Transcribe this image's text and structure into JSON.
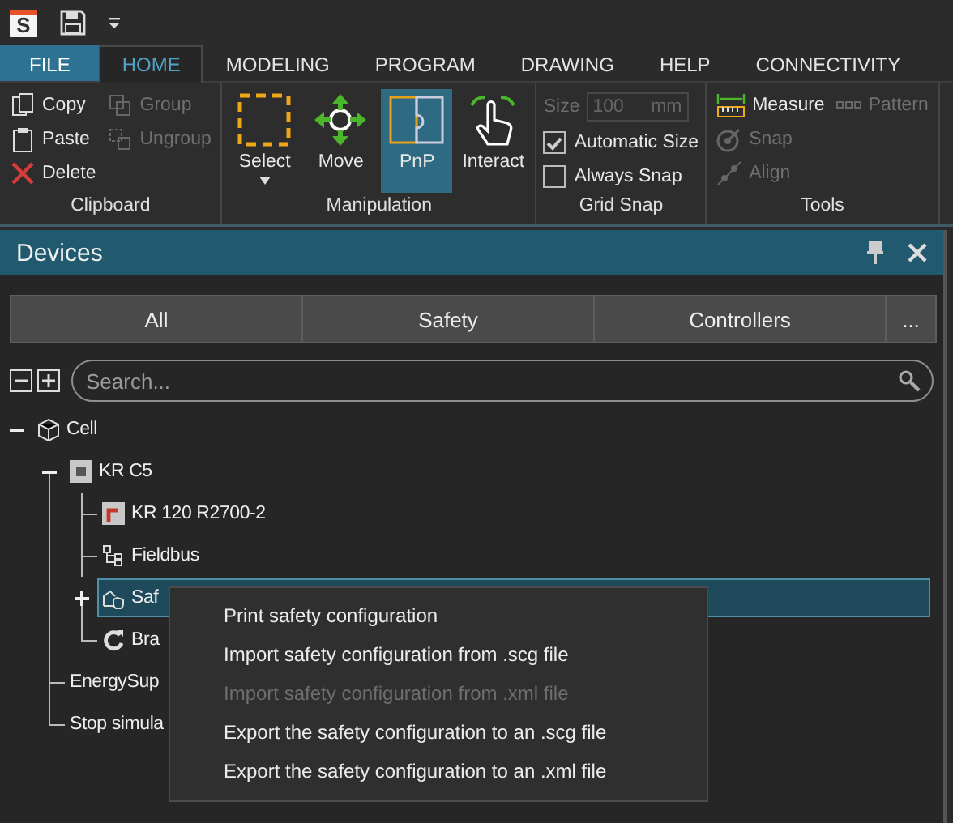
{
  "title_bar": {
    "logo": "S"
  },
  "ribbon": {
    "tabs": [
      {
        "label": "FILE",
        "kind": "file",
        "selected": false
      },
      {
        "label": "HOME",
        "kind": "tab",
        "selected": true
      },
      {
        "label": "MODELING",
        "kind": "tab",
        "selected": false
      },
      {
        "label": "PROGRAM",
        "kind": "tab",
        "selected": false
      },
      {
        "label": "DRAWING",
        "kind": "tab",
        "selected": false
      },
      {
        "label": "HELP",
        "kind": "tab",
        "selected": false
      },
      {
        "label": "CONNECTIVITY",
        "kind": "tab",
        "selected": false
      }
    ],
    "groups": [
      {
        "label": "Clipboard",
        "columns": [
          [
            {
              "kind": "small",
              "label": "Copy",
              "disabled": false
            },
            {
              "kind": "small",
              "label": "Paste",
              "disabled": false
            },
            {
              "kind": "small",
              "label": "Delete",
              "disabled": false
            }
          ],
          [
            {
              "kind": "small",
              "label": "Group",
              "disabled": true
            },
            {
              "kind": "small",
              "label": "Ungroup",
              "disabled": true
            }
          ]
        ]
      },
      {
        "label": "Manipulation",
        "columns": [
          [
            {
              "kind": "large",
              "label": "Select",
              "dropdown": true,
              "selected": false
            }
          ],
          [
            {
              "kind": "large",
              "label": "Move",
              "selected": false
            }
          ],
          [
            {
              "kind": "large",
              "label": "PnP",
              "selected": true
            }
          ],
          [
            {
              "kind": "large",
              "label": "Interact",
              "selected": false
            }
          ]
        ]
      },
      {
        "label": "Grid Snap",
        "columns": [
          [
            {
              "kind": "field",
              "label": "Size",
              "value": "100",
              "unit": "mm",
              "disabled": true
            },
            {
              "kind": "checkbox",
              "label": "Automatic Size",
              "checked": true
            },
            {
              "kind": "checkbox",
              "label": "Always Snap",
              "checked": false
            }
          ]
        ]
      },
      {
        "label": "Tools",
        "columns": [
          [
            {
              "kind": "small",
              "label": "Measure",
              "disabled": false
            },
            {
              "kind": "small",
              "label": "Snap",
              "disabled": true
            },
            {
              "kind": "small",
              "label": "Align",
              "disabled": true
            }
          ],
          [
            {
              "kind": "small",
              "label": "Pattern",
              "disabled": true
            }
          ]
        ]
      }
    ]
  },
  "devices_panel": {
    "title": "Devices",
    "filters": [
      {
        "label": "All",
        "selected": false
      },
      {
        "label": "Safety",
        "selected": false
      },
      {
        "label": "Controllers",
        "selected": false
      },
      {
        "label": "...",
        "selected": false
      }
    ],
    "search": {
      "placeholder": "Search..."
    },
    "tree": [
      {
        "label": "Cell",
        "expanded": true,
        "selected": false,
        "children": [
          {
            "label": "KR C5",
            "expanded": true,
            "selected": false,
            "children": [
              {
                "label": "KR 120 R2700-2",
                "selected": false
              },
              {
                "label": "Fieldbus",
                "selected": false
              },
              {
                "label": "Saf",
                "expanded": false,
                "selected": true
              },
              {
                "label": "Bra",
                "selected": false
              }
            ]
          },
          {
            "label": "EnergySup",
            "selected": false
          },
          {
            "label": "Stop simula",
            "selected": false
          }
        ]
      }
    ]
  },
  "context_menu": {
    "items": [
      {
        "label": "Print safety configuration",
        "disabled": false
      },
      {
        "label": "Import safety configuration from .scg file",
        "disabled": false
      },
      {
        "label": "Import safety configuration from .xml file",
        "disabled": true
      },
      {
        "label": "Export the safety configuration to an .scg file",
        "disabled": false
      },
      {
        "label": "Export the safety configuration to an .xml file",
        "disabled": false
      }
    ]
  }
}
